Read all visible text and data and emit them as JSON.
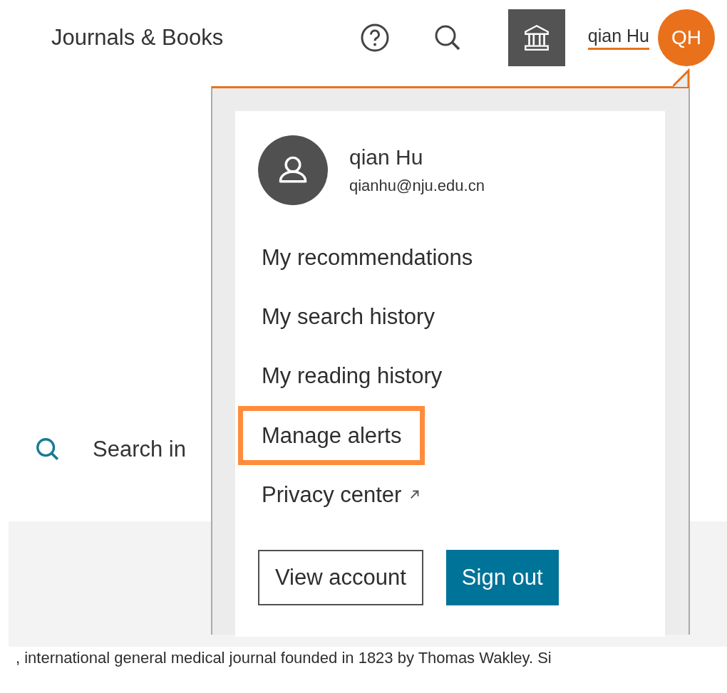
{
  "header": {
    "title": "Journals & Books",
    "user_name": "qian Hu",
    "avatar_initials": "QH"
  },
  "search": {
    "placeholder": "Search in"
  },
  "description": ", international general medical journal founded in 1823 by Thomas Wakley. Si",
  "account_menu": {
    "name": "qian Hu",
    "email": "qianhu@nju.edu.cn",
    "items": [
      {
        "label": "My recommendations",
        "selected": false,
        "external": false
      },
      {
        "label": "My search history",
        "selected": false,
        "external": false
      },
      {
        "label": "My reading history",
        "selected": false,
        "external": false
      },
      {
        "label": "Manage alerts",
        "selected": true,
        "external": false
      },
      {
        "label": "Privacy center",
        "selected": false,
        "external": true
      }
    ],
    "buttons": [
      {
        "label": "View account",
        "kind": "outline"
      },
      {
        "label": "Sign out",
        "kind": "primary"
      }
    ]
  }
}
